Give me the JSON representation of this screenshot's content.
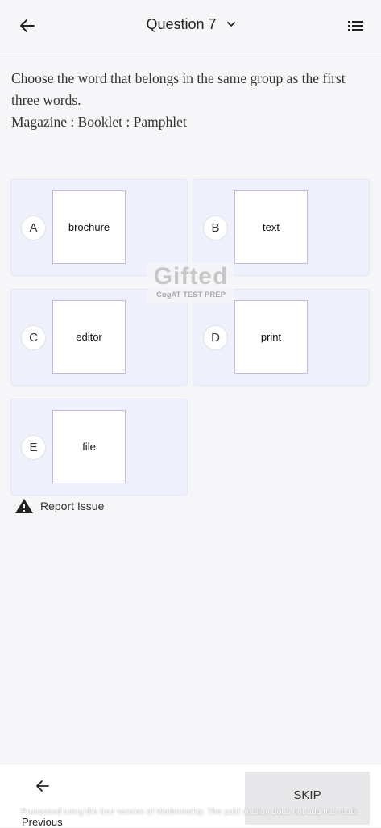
{
  "header": {
    "title": "Question 7"
  },
  "question": {
    "prompt": "Choose the word that belongs in the same group as the first three words.",
    "words": "Magazine : Booklet : Pamphlet"
  },
  "options": [
    {
      "letter": "A",
      "word": "brochure"
    },
    {
      "letter": "B",
      "word": "text"
    },
    {
      "letter": "C",
      "word": "editor"
    },
    {
      "letter": "D",
      "word": "print"
    },
    {
      "letter": "E",
      "word": "file"
    }
  ],
  "logo": {
    "title": "Gifted",
    "subtitle": "CogAT TEST PREP"
  },
  "report": {
    "label": "Report Issue"
  },
  "footer": {
    "previous_label": "Previous",
    "skip_label": "SKIP",
    "note": "Processed using the free version of Watermarkly. The paid version does not add this mark."
  }
}
